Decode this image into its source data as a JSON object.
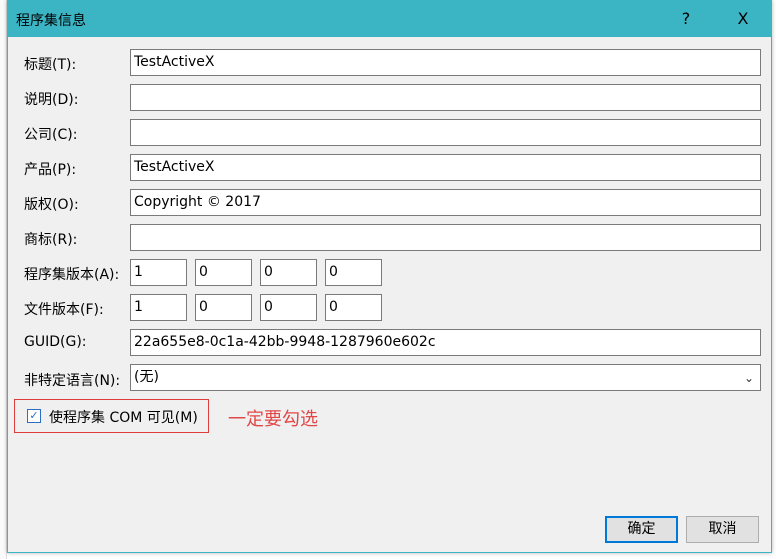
{
  "title": "程序集信息",
  "help_label": "?",
  "close_label": "X",
  "fields": [
    {
      "label": "标题(T):",
      "value": "TestActiveX"
    },
    {
      "label": "说明(D):",
      "value": ""
    },
    {
      "label": "公司(C):",
      "value": ""
    },
    {
      "label": "产品(P):",
      "value": "TestActiveX"
    },
    {
      "label": "版权(O):",
      "value": "Copyright ©  2017"
    },
    {
      "label": "商标(R):",
      "value": ""
    }
  ],
  "assembly_version": {
    "label": "程序集版本(A):",
    "parts": [
      "1",
      "0",
      "0",
      "0"
    ]
  },
  "file_version": {
    "label": "文件版本(F):",
    "parts": [
      "1",
      "0",
      "0",
      "0"
    ]
  },
  "guid": {
    "label": "GUID(G):",
    "value": "22a655e8-0c1a-42bb-9948-1287960e602c"
  },
  "language": {
    "label": "非特定语言(N):",
    "value": "(无)"
  },
  "com_visible": {
    "label": "使程序集 COM 可见(M)",
    "checked": true
  },
  "annotation": "一定要勾选",
  "ok_label": "确定",
  "cancel_label": "取消",
  "colors": {
    "titlebar": "#3bb4c4",
    "annotation": "#e04848"
  }
}
